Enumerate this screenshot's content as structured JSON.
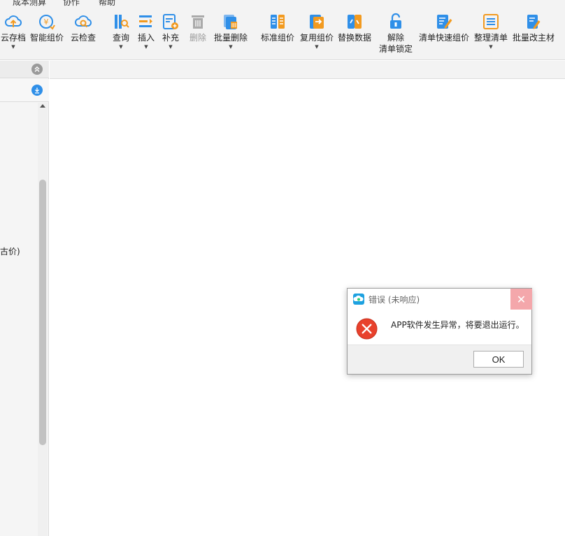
{
  "menubar": {
    "items": [
      "成本测算",
      "协作",
      "帮助"
    ]
  },
  "toolbar": {
    "items": [
      {
        "label": "云存档",
        "caret": true,
        "icon": "cloud-upload-icon"
      },
      {
        "label": "智能组价",
        "caret": false,
        "icon": "smart-price-icon"
      },
      {
        "label": "云检查",
        "caret": false,
        "icon": "cloud-check-icon"
      },
      {
        "label": "查询",
        "caret": true,
        "icon": "query-icon"
      },
      {
        "label": "插入",
        "caret": true,
        "icon": "insert-icon"
      },
      {
        "label": "补充",
        "caret": true,
        "icon": "supplement-icon"
      },
      {
        "label": "删除",
        "caret": false,
        "icon": "trash-icon",
        "disabled": true
      },
      {
        "label": "批量删除",
        "caret": true,
        "icon": "batch-delete-icon"
      },
      {
        "label": "标准组价",
        "caret": false,
        "icon": "standard-price-icon"
      },
      {
        "label": "复用组价",
        "caret": true,
        "icon": "reuse-price-icon"
      },
      {
        "label": "替换数据",
        "caret": false,
        "icon": "replace-data-icon"
      },
      {
        "label": "解除",
        "label2": "清单锁定",
        "caret": false,
        "icon": "unlock-icon"
      },
      {
        "label": "清单快速组价",
        "caret": false,
        "icon": "quick-price-icon"
      },
      {
        "label": "整理清单",
        "caret": true,
        "icon": "organize-list-icon"
      },
      {
        "label": "批量改主材",
        "caret": false,
        "icon": "batch-material-icon"
      }
    ]
  },
  "leftpanel": {
    "partial_text": "古价)"
  },
  "dialog": {
    "title": "错误 (未响应)",
    "message": "APP软件发生异常，将要退出运行。",
    "ok_label": "OK",
    "close_glyph": "✕"
  },
  "colors": {
    "accent_blue": "#2f8fe8",
    "accent_orange": "#f29a1f",
    "error_red": "#e8412c",
    "close_hover": "#f4a7ab"
  }
}
